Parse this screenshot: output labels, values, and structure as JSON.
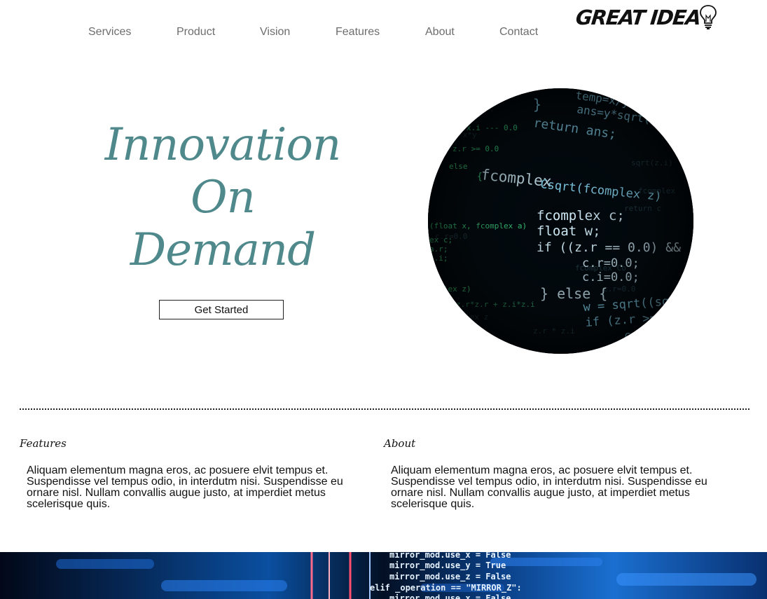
{
  "nav": {
    "items": [
      "Services",
      "Product",
      "Vision",
      "Features",
      "About",
      "Contact"
    ],
    "logo": "GREAT IDEA"
  },
  "hero": {
    "title_lines": [
      "Innovation",
      "On",
      "Demand"
    ],
    "cta_label": "Get Started",
    "image_icon": "code-screen-image"
  },
  "sections": [
    {
      "title": "Features",
      "body": "Aliquam elementum magna eros, ac posuere elvit tempus et. Suspendisse vel tempus odio, in interdutm nisi. Suspendisse eu ornare nisl. Nullam convallis augue justo, at imperdiet metus scelerisque quis."
    },
    {
      "title": "About",
      "body": "Aliquam elementum magna eros, ac posuere elvit tempus et. Suspendisse vel tempus odio, in interdutm nisi. Suspendisse eu ornare nisl. Nullam convallis augue justo, at imperdiet metus scelerisque quis."
    }
  ],
  "colors": {
    "accent": "#4f898b",
    "nav_text": "#6d6d6d",
    "code_cyan": "#7fd8ff",
    "code_green": "#3ddc84"
  }
}
